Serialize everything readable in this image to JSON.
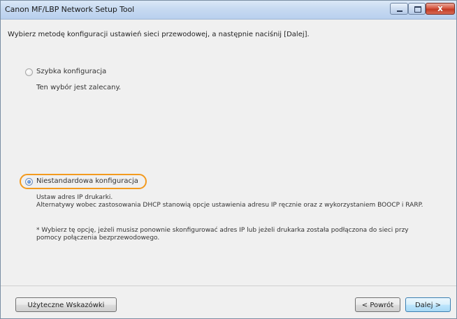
{
  "window": {
    "title": "Canon MF/LBP Network Setup Tool",
    "minimize_icon": "minimize-icon",
    "maximize_icon": "maximize-icon",
    "close_icon": "close-icon",
    "close_glyph": "x"
  },
  "content": {
    "instruction": "Wybierz metodę konfiguracji ustawień sieci przewodowej, a następnie naciśnij [Dalej].",
    "options": [
      {
        "label": "Szybka konfiguracja",
        "description": "Ten wybór jest zalecany.",
        "selected": false
      },
      {
        "label": "Niestandardowa konfiguracja",
        "description_line1": "Ustaw adres IP drukarki.",
        "description_line2": "Alternatywy wobec zastosowania DHCP stanowią opcje ustawienia adresu IP ręcznie oraz z wykorzystaniem BOOCP i RARP.",
        "note_line1": "* Wybierz tę opcję, jeżeli musisz ponownie skonfigurować adres IP lub jeżeli drukarka została podłączona do sieci przy",
        "note_line2": "pomocy połączenia bezprzewodowego.",
        "selected": true,
        "highlight_color": "#f39a1e"
      }
    ]
  },
  "footer": {
    "tips_button": "Użyteczne Wskazówki",
    "back_button": "< Powrót",
    "next_button": "Dalej >"
  }
}
